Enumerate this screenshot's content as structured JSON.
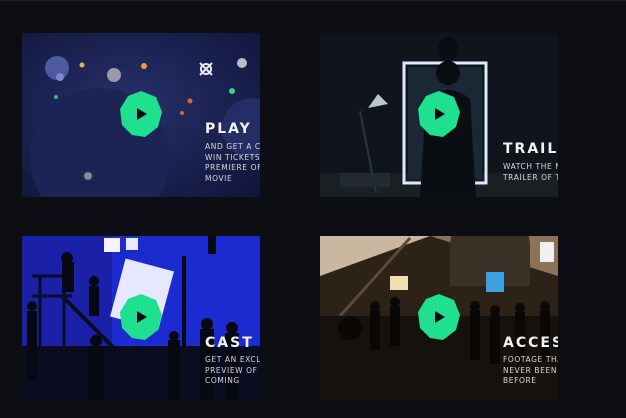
{
  "accent_color": "#1ee08f",
  "cards": [
    {
      "title": "PLAY",
      "description": "AND GET A CHANCE TO WIN TICKETS TO THE PREMIERE OF THE MOVIE",
      "icon": "play-icon"
    },
    {
      "title": "TRAILER",
      "description": "WATCH THE NEW TRAILER OF THE MOVIE",
      "icon": "play-icon"
    },
    {
      "title": "CAST",
      "description": "GET AN EXCLUSIVE PREVIEW OF WHAT'S COMING",
      "icon": "play-icon"
    },
    {
      "title": "ACCESS",
      "description": "FOOTAGE THAT HAS NEVER BEEN SEEN BEFORE",
      "icon": "play-icon"
    }
  ]
}
